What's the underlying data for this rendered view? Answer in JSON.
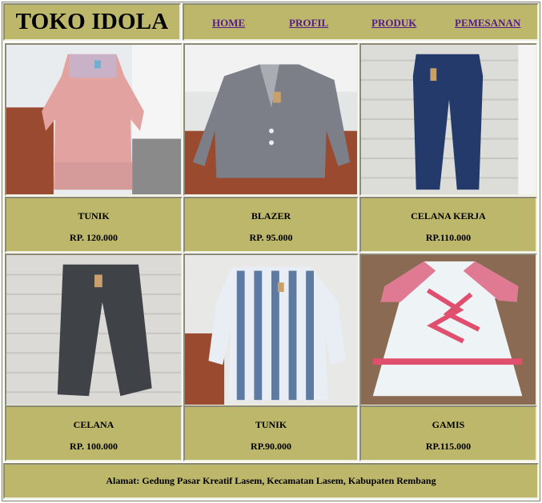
{
  "header": {
    "store_name": "TOKO IDOLA",
    "nav": [
      {
        "label": "HOME"
      },
      {
        "label": "PROFIL"
      },
      {
        "label": "PRODUK"
      },
      {
        "label": "PEMESANAN"
      }
    ]
  },
  "products": [
    {
      "name": "TUNIK",
      "price": "RP. 120.000",
      "image_icon": "pink-tunic-photo"
    },
    {
      "name": "BLAZER",
      "price": "RP. 95.000",
      "image_icon": "checkered-blazer-photo"
    },
    {
      "name": "CELANA KERJA",
      "price": "RP.110.000",
      "image_icon": "navy-work-pants-photo"
    },
    {
      "name": "CELANA",
      "price": "RP. 100.000",
      "image_icon": "gray-pants-photo"
    },
    {
      "name": "TUNIK",
      "price": "RP.90.000",
      "image_icon": "striped-tunic-photo"
    },
    {
      "name": "GAMIS",
      "price": "RP.115.000",
      "image_icon": "floral-gamis-photo"
    }
  ],
  "footer": {
    "address": "Alamat: Gedung Pasar Kreatif Lasem, Kecamatan Lasem, Kabupaten Rembang"
  },
  "colors": {
    "cell_background": "#bdb76b",
    "link": "#551a8b"
  }
}
